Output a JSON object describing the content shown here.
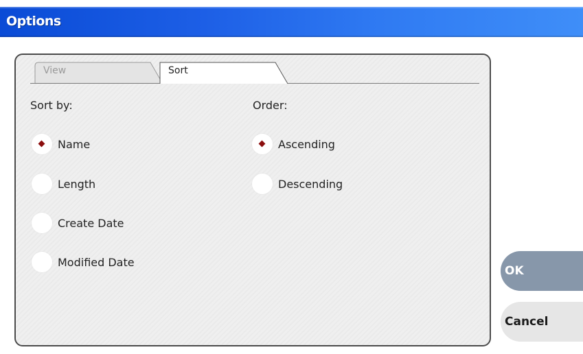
{
  "window": {
    "title": "Options"
  },
  "tabs": [
    {
      "label": "View",
      "active": false
    },
    {
      "label": "Sort",
      "active": true
    }
  ],
  "sort_by": {
    "heading": "Sort by:",
    "options": [
      {
        "label": "Name",
        "selected": true
      },
      {
        "label": "Length",
        "selected": false
      },
      {
        "label": "Create Date",
        "selected": false
      },
      {
        "label": "Modified Date",
        "selected": false
      }
    ]
  },
  "order": {
    "heading": "Order:",
    "options": [
      {
        "label": "Ascending",
        "selected": true
      },
      {
        "label": "Descending",
        "selected": false
      }
    ]
  },
  "buttons": {
    "ok_label": "OK",
    "cancel_label": "Cancel"
  },
  "colors": {
    "title_bar": "#1d5fe6",
    "radio_selected_marker": "#8b0d0d",
    "ok_button": "#8797aa"
  },
  "icons": {
    "selected_radio": "diamond-dot-icon"
  }
}
